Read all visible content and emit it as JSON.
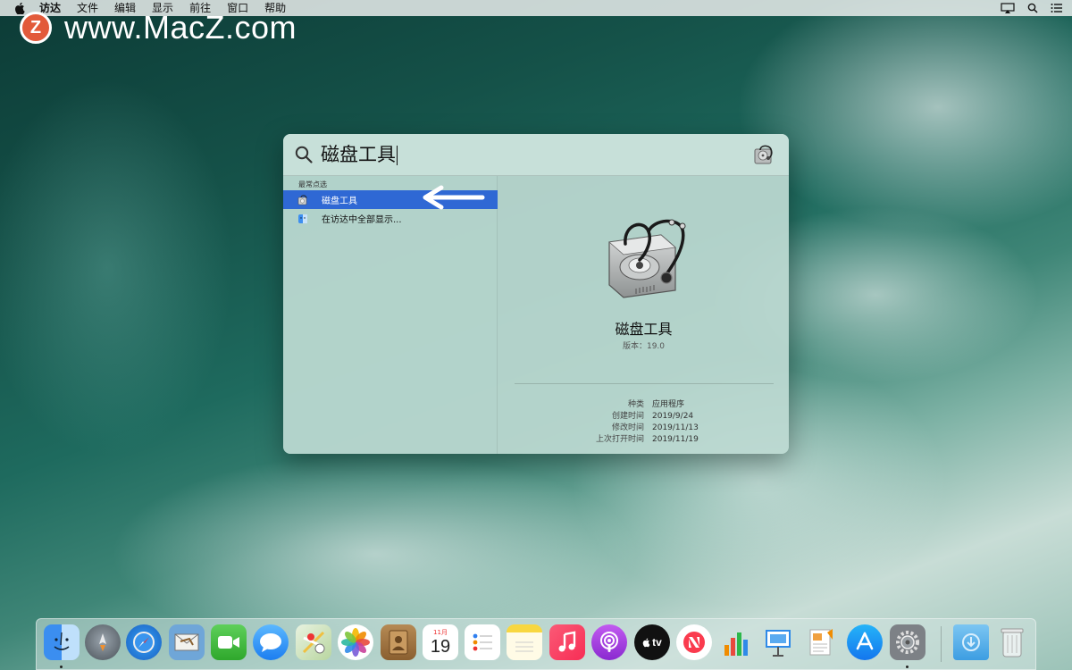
{
  "menubar": {
    "items": [
      "访达",
      "文件",
      "编辑",
      "显示",
      "前往",
      "窗口",
      "帮助"
    ]
  },
  "watermark": {
    "logo_letter": "Z",
    "text": "www.MacZ.com"
  },
  "spotlight": {
    "query": "磁盘工具",
    "section_label": "最常点选",
    "results": [
      {
        "label": "磁盘工具",
        "icon": "disk-utility-icon",
        "selected": true
      },
      {
        "label": "在访达中全部显示...",
        "icon": "finder-icon",
        "selected": false
      }
    ],
    "preview": {
      "name": "磁盘工具",
      "version": "版本：19.0",
      "meta": [
        {
          "key": "种类",
          "value": "应用程序"
        },
        {
          "key": "创建时间",
          "value": "2019/9/24"
        },
        {
          "key": "修改时间",
          "value": "2019/11/13"
        },
        {
          "key": "上次打开时间",
          "value": "2019/11/19"
        }
      ]
    }
  },
  "dock": {
    "calendar_month": "11月",
    "calendar_day": "19",
    "tv_label": "tv",
    "apps": [
      "finder",
      "launchpad",
      "safari",
      "mail",
      "facetime",
      "messages",
      "maps",
      "photos",
      "contacts",
      "calendar",
      "reminders",
      "notes",
      "music",
      "podcasts",
      "apple-tv",
      "news",
      "numbers",
      "keynote",
      "pages",
      "app-store",
      "system-preferences",
      "downloads",
      "trash"
    ]
  },
  "colors": {
    "selection": "#2f68d4",
    "accent_orange": "#e25a3a"
  }
}
